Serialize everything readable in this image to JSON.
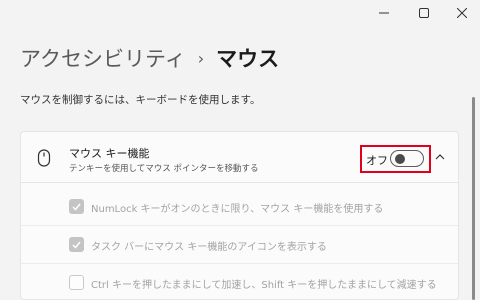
{
  "window": {
    "minimize_icon": "minimize-icon",
    "maximize_icon": "maximize-icon",
    "close_icon": "close-icon"
  },
  "breadcrumb": {
    "parent": "アクセシビリティ",
    "separator": "›",
    "current": "マウス"
  },
  "page": {
    "description": "マウスを制御するには、キーボードを使用します。"
  },
  "mouse_keys": {
    "icon": "mouse-icon",
    "title": "マウス キー機能",
    "subtitle": "テンキーを使用してマウス ポインターを移動する",
    "toggle_state_label": "オフ",
    "toggle_on": false,
    "expanded": true,
    "chevron_icon": "chevron-up-icon",
    "highlight_color": "#e0001b",
    "options": [
      {
        "label": "NumLock キーがオンのときに限り、マウス キー機能を使用する",
        "checked": true,
        "disabled": true
      },
      {
        "label": "タスク バーにマウス キー機能のアイコンを表示する",
        "checked": true,
        "disabled": true
      },
      {
        "label": "Ctrl キーを押したままにして加速し、Shift キーを押したままにして減速する",
        "checked": false,
        "disabled": true
      }
    ]
  }
}
